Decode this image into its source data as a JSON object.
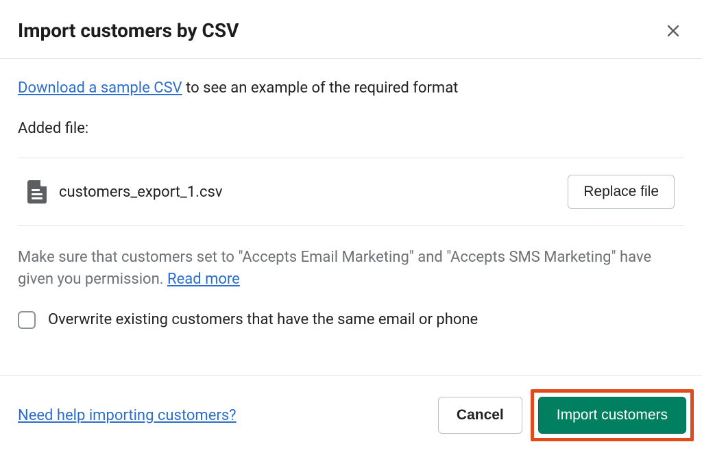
{
  "modal": {
    "title": "Import customers by CSV"
  },
  "sample": {
    "link_label": "Download a sample CSV",
    "trailer": " to see an example of the required format"
  },
  "added_file": {
    "label": "Added file:",
    "name": "customers_export_1.csv",
    "replace_label": "Replace file"
  },
  "permission": {
    "text_before": "Make sure that customers set to \"Accepts Email Marketing\" and \"Accepts SMS Marketing\" have given you permission. ",
    "read_more_label": "Read more"
  },
  "overwrite": {
    "label": "Overwrite existing customers that have the same email or phone"
  },
  "footer": {
    "help_label": "Need help importing customers?",
    "cancel_label": "Cancel",
    "import_label": "Import customers"
  }
}
